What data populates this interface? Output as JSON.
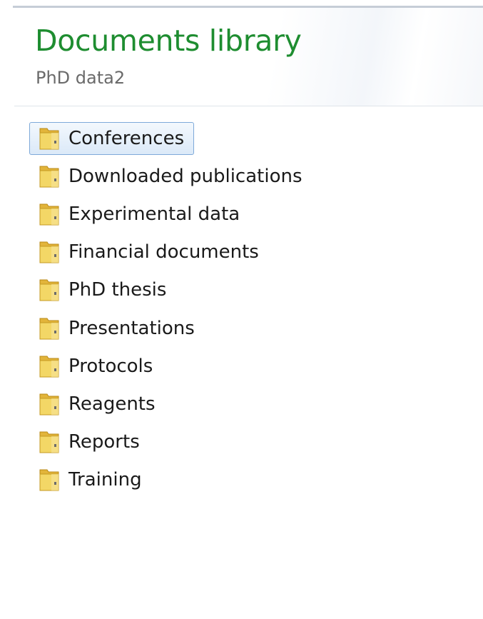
{
  "library": {
    "title": "Documents library",
    "subtitle": "PhD data2"
  },
  "folders": [
    {
      "label": "Conferences",
      "selected": true,
      "icon": "folder-icon"
    },
    {
      "label": "Downloaded publications",
      "selected": false,
      "icon": "folder-icon"
    },
    {
      "label": "Experimental data",
      "selected": false,
      "icon": "folder-icon"
    },
    {
      "label": "Financial documents",
      "selected": false,
      "icon": "folder-icon"
    },
    {
      "label": "PhD thesis",
      "selected": false,
      "icon": "folder-icon"
    },
    {
      "label": "Presentations",
      "selected": false,
      "icon": "folder-icon"
    },
    {
      "label": "Protocols",
      "selected": false,
      "icon": "folder-icon"
    },
    {
      "label": "Reagents",
      "selected": false,
      "icon": "folder-icon"
    },
    {
      "label": "Reports",
      "selected": false,
      "icon": "folder-icon"
    },
    {
      "label": "Training",
      "selected": false,
      "icon": "folder-icon"
    }
  ],
  "colors": {
    "title": "#1e8d30",
    "subtitle": "#6a6a6a",
    "selection_border": "#7ea9d9",
    "folder_yellow": "#f2cd4a"
  }
}
